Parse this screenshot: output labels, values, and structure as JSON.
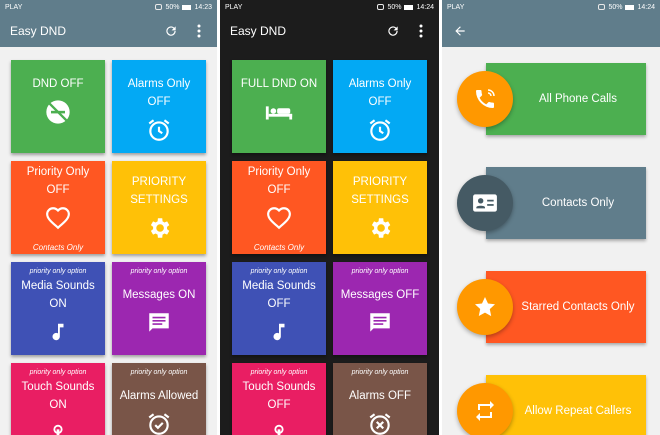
{
  "status_left": [
    "PLAY",
    "PLAY",
    "PLAY"
  ],
  "status_right": [
    "50% ▢ 14:23",
    "50% ▢ 14:24",
    "50% ▢ 14:24"
  ],
  "s1": {
    "title": "Easy DND",
    "tiles": [
      {
        "sub": "",
        "title": "DND OFF",
        "icon": "dnd-off-icon",
        "foot": ""
      },
      {
        "sub": "",
        "title": "Alarms Only",
        "title2": "OFF",
        "icon": "alarm-icon",
        "foot": ""
      },
      {
        "sub": "",
        "title": "Priority Only",
        "title2": "OFF",
        "icon": "heart-icon",
        "foot": "Contacts Only"
      },
      {
        "sub": "",
        "title": "PRIORITY",
        "title2": "SETTINGS",
        "icon": "gear-icon",
        "foot": ""
      },
      {
        "sub": "priority only option",
        "title": "Media Sounds",
        "title2": "ON",
        "icon": "music-note-icon",
        "foot": ""
      },
      {
        "sub": "priority only option",
        "title": "Messages ON",
        "icon": "message-icon",
        "foot": ""
      },
      {
        "sub": "priority only option",
        "title": "Touch Sounds",
        "title2": "ON",
        "icon": "touch-icon",
        "foot": ""
      },
      {
        "sub": "priority only option",
        "title": "Alarms Allowed",
        "icon": "alarm-icon",
        "foot": ""
      }
    ]
  },
  "s2": {
    "title": "Easy DND",
    "tiles": [
      {
        "sub": "",
        "title": "FULL DND ON",
        "icon": "bed-icon",
        "foot": ""
      },
      {
        "sub": "",
        "title": "Alarms Only",
        "title2": "OFF",
        "icon": "alarm-icon",
        "foot": ""
      },
      {
        "sub": "",
        "title": "Priority Only",
        "title2": "OFF",
        "icon": "heart-icon",
        "foot": "Contacts Only"
      },
      {
        "sub": "",
        "title": "PRIORITY",
        "title2": "SETTINGS",
        "icon": "gear-icon",
        "foot": ""
      },
      {
        "sub": "priority only option",
        "title": "Media Sounds",
        "title2": "OFF",
        "icon": "music-note-icon",
        "foot": ""
      },
      {
        "sub": "priority only option",
        "title": "Messages OFF",
        "icon": "message-icon",
        "foot": ""
      },
      {
        "sub": "priority only option",
        "title": "Touch Sounds",
        "title2": "OFF",
        "icon": "touch-icon",
        "foot": ""
      },
      {
        "sub": "priority only option",
        "title": "Alarms OFF",
        "icon": "alarm-icon",
        "foot": ""
      }
    ]
  },
  "s3": {
    "options": [
      {
        "label": "All Phone Calls",
        "icon": "phone-call-icon",
        "color": "#4caf50",
        "circle": "#ff9800"
      },
      {
        "label": "Contacts Only",
        "icon": "contact-card-icon",
        "color": "#607d8b",
        "circle": "#455a64"
      },
      {
        "label": "Starred Contacts Only",
        "icon": "star-icon",
        "color": "#ff5722",
        "circle": "#ff9800"
      },
      {
        "label": "Allow Repeat Callers",
        "icon": "repeat-icon",
        "color": "#ffc107",
        "circle": "#ff9800"
      }
    ]
  }
}
